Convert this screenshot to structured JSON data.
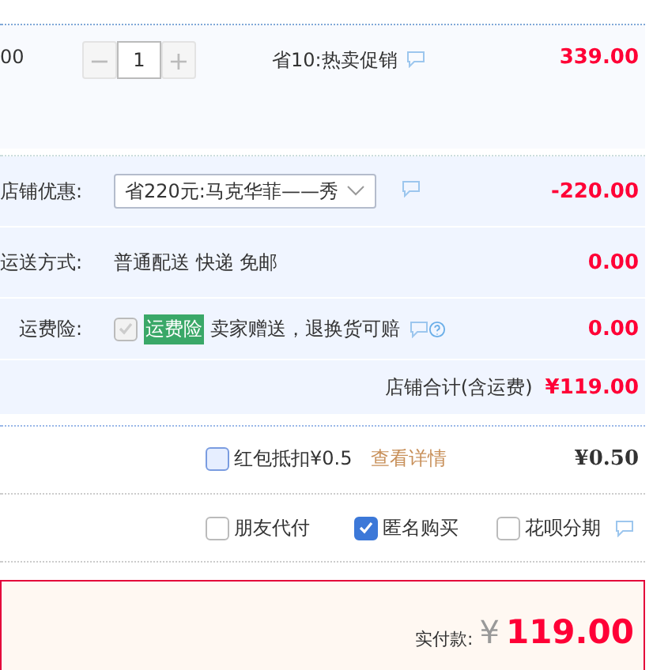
{
  "item": {
    "price_fragment": "00",
    "quantity": "1",
    "minus": "−",
    "plus": "+",
    "promo": "省10:热卖促销",
    "subtotal": "339.00"
  },
  "shop": {
    "rows": [
      {
        "kind": "select",
        "label": "店铺优惠:",
        "value": "省220元:马克华菲——秀",
        "amount": "-220.00"
      },
      {
        "kind": "text",
        "label": "运送方式:",
        "value": "普通配送 快递 免邮",
        "amount": "0.00"
      },
      {
        "kind": "insurance",
        "label": "运费险:",
        "tag": "运费险",
        "value": "卖家赠送，退换货可赔",
        "checked": true,
        "disabled": true,
        "amount": "0.00"
      }
    ],
    "total_label": "店铺合计(含运费)",
    "total": "¥119.00"
  },
  "redpacket": {
    "label": "红包抵扣¥0.5",
    "checked": false,
    "link": "查看详情",
    "amount": "¥0.50"
  },
  "options": [
    {
      "label": "朋友代付",
      "checked": false
    },
    {
      "label": "匿名购买",
      "checked": true
    },
    {
      "label": "花呗分期",
      "checked": false,
      "help": true
    }
  ],
  "payment": {
    "label": "实付款:",
    "currency": "¥",
    "amount": "119.00"
  }
}
